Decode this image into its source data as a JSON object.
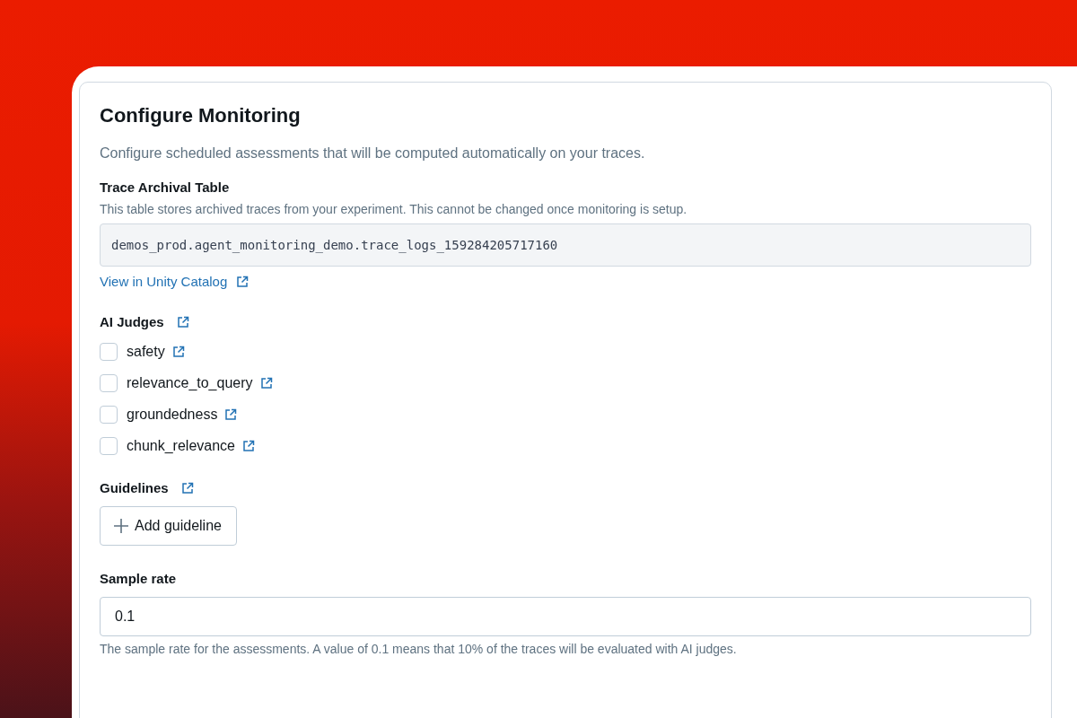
{
  "title": "Configure Monitoring",
  "description": "Configure scheduled assessments that will be computed automatically on your traces.",
  "archival_table": {
    "label": "Trace Archival Table",
    "help": "This table stores archived traces from your experiment. This cannot be changed once monitoring is setup.",
    "value": "demos_prod.agent_monitoring_demo.trace_logs_159284205717160",
    "link": "View in Unity Catalog"
  },
  "ai_judges": {
    "label": "AI Judges",
    "items": [
      {
        "name": "safety",
        "checked": false
      },
      {
        "name": "relevance_to_query",
        "checked": false
      },
      {
        "name": "groundedness",
        "checked": false
      },
      {
        "name": "chunk_relevance",
        "checked": false
      }
    ]
  },
  "guidelines": {
    "label": "Guidelines",
    "button": "Add guideline"
  },
  "sample_rate": {
    "label": "Sample rate",
    "value": "0.1",
    "help": "The sample rate for the assessments. A value of 0.1 means that 10% of the traces will be evaluated with AI judges."
  }
}
